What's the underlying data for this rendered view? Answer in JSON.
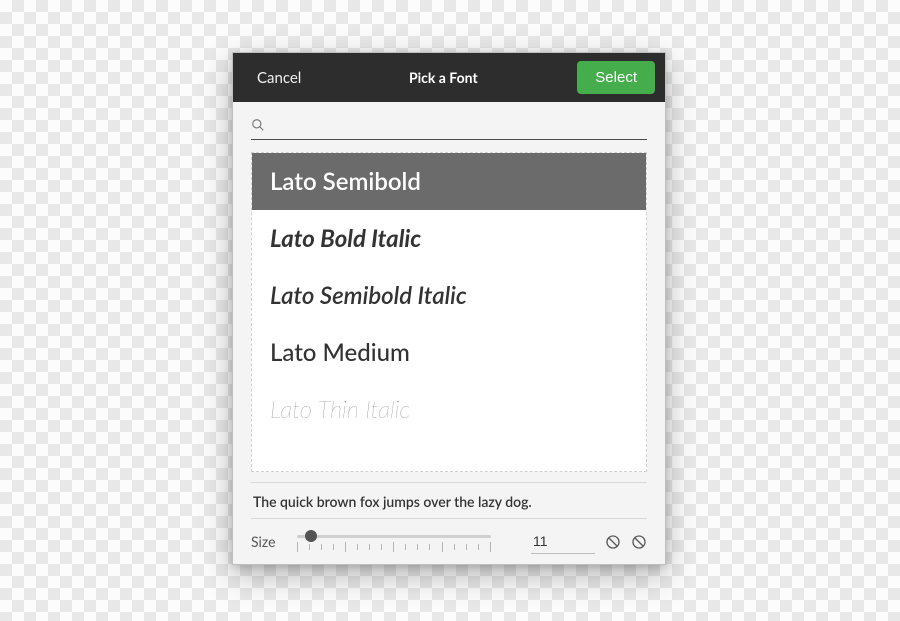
{
  "header": {
    "cancel_label": "Cancel",
    "title": "Pick a Font",
    "select_label": "Select"
  },
  "search": {
    "placeholder": "",
    "value": ""
  },
  "fonts": [
    {
      "name": "Lato Semibold",
      "style_class": "semibold",
      "selected": true
    },
    {
      "name": "Lato Bold Italic",
      "style_class": "bold-italic",
      "selected": false
    },
    {
      "name": "Lato Semibold Italic",
      "style_class": "semibold-italic",
      "selected": false
    },
    {
      "name": "Lato Medium",
      "style_class": "medium",
      "selected": false
    },
    {
      "name": "Lato Thin Italic",
      "style_class": "thin-italic",
      "selected": false
    }
  ],
  "preview_text": "The quick brown fox jumps over the lazy dog.",
  "size": {
    "label": "Size",
    "value": "11"
  }
}
